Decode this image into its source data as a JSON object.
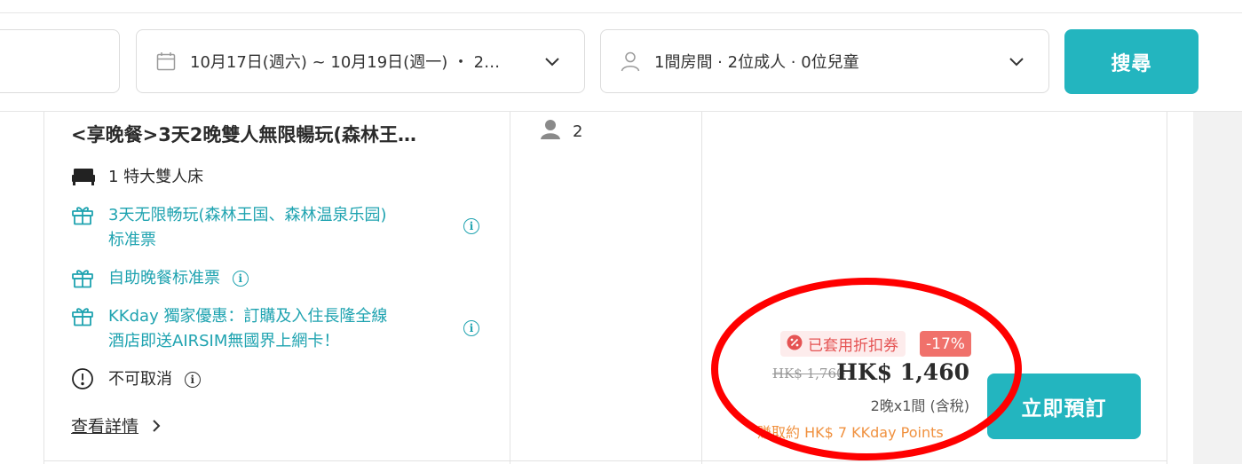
{
  "search": {
    "dates": "10月17日(週六) ~ 10月19日(週一) ・ 2…",
    "guests": "1間房間 · 2位成人 · 0位兒童",
    "search_label": "搜尋"
  },
  "room": {
    "title": "<享晚餐>3天2晚雙人無限暢玩(森林王…",
    "bed": "1 特大雙人床",
    "perk1_line1": "3天无限畅玩(森林王国、森林温泉乐园)",
    "perk1_line2": "标准票",
    "perk2": "自助晚餐标准票",
    "perk3_line1": "KKday 獨家優惠：訂購及入住長隆全線",
    "perk3_line2": "酒店即送AIRSIM無國界上網卡！",
    "policy": "不可取消",
    "details_label": "查看詳情",
    "occupancy": "2"
  },
  "price": {
    "coupon_label": "已套用折扣券",
    "discount": "-17%",
    "original": "HK$ 1,760",
    "current": "HK$ 1,460",
    "stay_info": "2晚x1間 (含稅)",
    "points": "賺取約 HK$ 7 KKday Points",
    "book_label": "立即預訂"
  },
  "colors": {
    "accent": "#23b5bf",
    "teal_text": "#1fa3b0",
    "coupon_red": "#e55353",
    "discount_bg": "#f0716b",
    "points_orange": "#f0913f",
    "annotation": "#ff0000"
  },
  "icons": {
    "date": "calendar-icon",
    "guest": "person-icon",
    "dropdown": "chevron-down-icon",
    "bed": "bed-icon",
    "perk": "gift-icon",
    "policy": "alert-circle-icon",
    "info": "info-icon",
    "details": "chevron-right-icon",
    "coupon": "coupon-badge-icon"
  }
}
